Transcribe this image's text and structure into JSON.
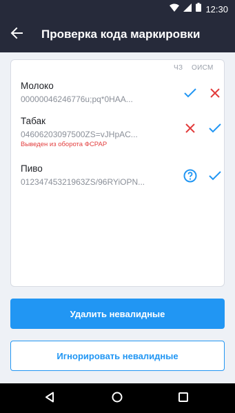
{
  "status_bar": {
    "time": "12:30"
  },
  "header": {
    "title": "Проверка кода маркировки"
  },
  "columns": {
    "cz": "ЧЗ",
    "oism": "ОИСМ"
  },
  "items": [
    {
      "name": "Молоко",
      "code": "00000046246776u;pq*0HAA...",
      "error": "",
      "cz": "check",
      "oism": "cross"
    },
    {
      "name": "Табак",
      "code": "04606203097500ZS=vJHpAC...",
      "error": "Выведен из оборота ФСРАР",
      "cz": "cross",
      "oism": "check"
    },
    {
      "name": "Пиво",
      "code": "01234745321963ZS/96RYiOPN...",
      "error": "",
      "cz": "question",
      "oism": "check"
    }
  ],
  "actions": {
    "delete_invalid": "Удалить невалидные",
    "ignore_invalid": "Игнорировать невалидные"
  },
  "colors": {
    "appbar": "#262a3a",
    "accent": "#2196f3",
    "error": "#e23c3c"
  }
}
